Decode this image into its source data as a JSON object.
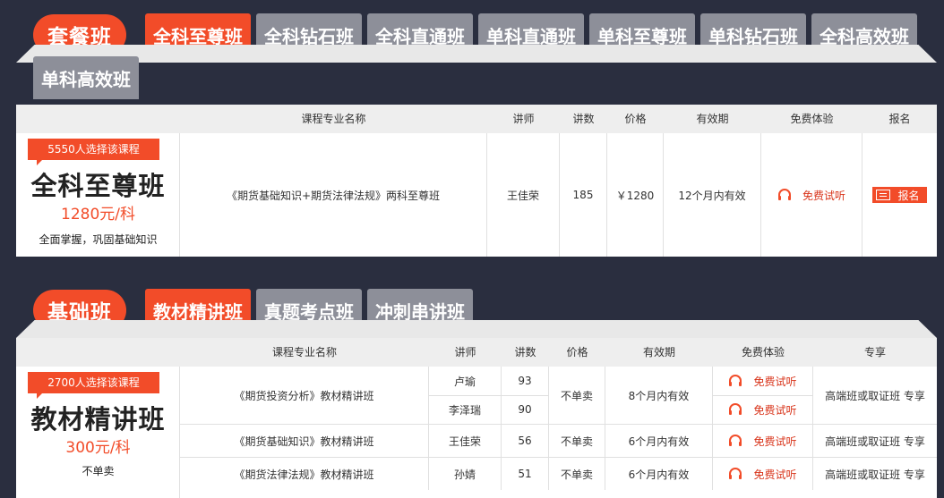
{
  "section1": {
    "title": "套餐班",
    "tabs": [
      "全科至尊班",
      "全科钻石班",
      "全科直通班",
      "单科直通班",
      "单科至尊班",
      "单科钻石班",
      "全科高效班",
      "单科高效班"
    ],
    "headers": [
      "课程专业名称",
      "讲师",
      "讲数",
      "价格",
      "有效期",
      "免费体验",
      "报名"
    ],
    "left": {
      "ribbon": "5550人选择该课程",
      "name": "全科至尊班",
      "price": "1280元/科",
      "desc": "全面掌握，巩固基础知识"
    },
    "row": {
      "course": "《期货基础知识+期货法律法规》两科至尊班",
      "teacher": "王佳荣",
      "lectures": "185",
      "price": "￥1280",
      "validity": "12个月内有效",
      "free": "免费试听",
      "signup": "报名"
    }
  },
  "section2": {
    "title": "基础班",
    "tabs": [
      "教材精讲班",
      "真题考点班",
      "冲刺串讲班"
    ],
    "headers": [
      "课程专业名称",
      "讲师",
      "讲数",
      "价格",
      "有效期",
      "免费体验",
      "专享"
    ],
    "left": {
      "ribbon": "2700人选择该课程",
      "name": "教材精讲班",
      "price": "300元/科",
      "desc": "不单卖"
    },
    "rows": [
      {
        "course": "《期货投资分析》教材精讲班",
        "teacher1": "卢瑜",
        "lectures1": "93",
        "teacher2": "李泽瑞",
        "lectures2": "90",
        "price": "不单卖",
        "validity": "8个月内有效",
        "free1": "免费试听",
        "free2": "免费试听",
        "exclusive": "高端班或取证班 专享"
      },
      {
        "course": "《期货基础知识》教材精讲班",
        "teacher": "王佳荣",
        "lectures": "56",
        "price": "不单卖",
        "validity": "6个月内有效",
        "free": "免费试听",
        "exclusive": "高端班或取证班 专享"
      },
      {
        "course": "《期货法律法规》教材精讲班",
        "teacher": "孙婧",
        "lectures": "51",
        "price": "不单卖",
        "validity": "6个月内有效",
        "free": "免费试听",
        "exclusive": "高端班或取证班 专享"
      }
    ]
  },
  "colors": {
    "accent": "#f24c29",
    "tab_inactive": "#8d8f99",
    "background": "#2a2e3f"
  },
  "icons": {
    "free_trial": "headphones-icon",
    "signup": "book-icon"
  }
}
